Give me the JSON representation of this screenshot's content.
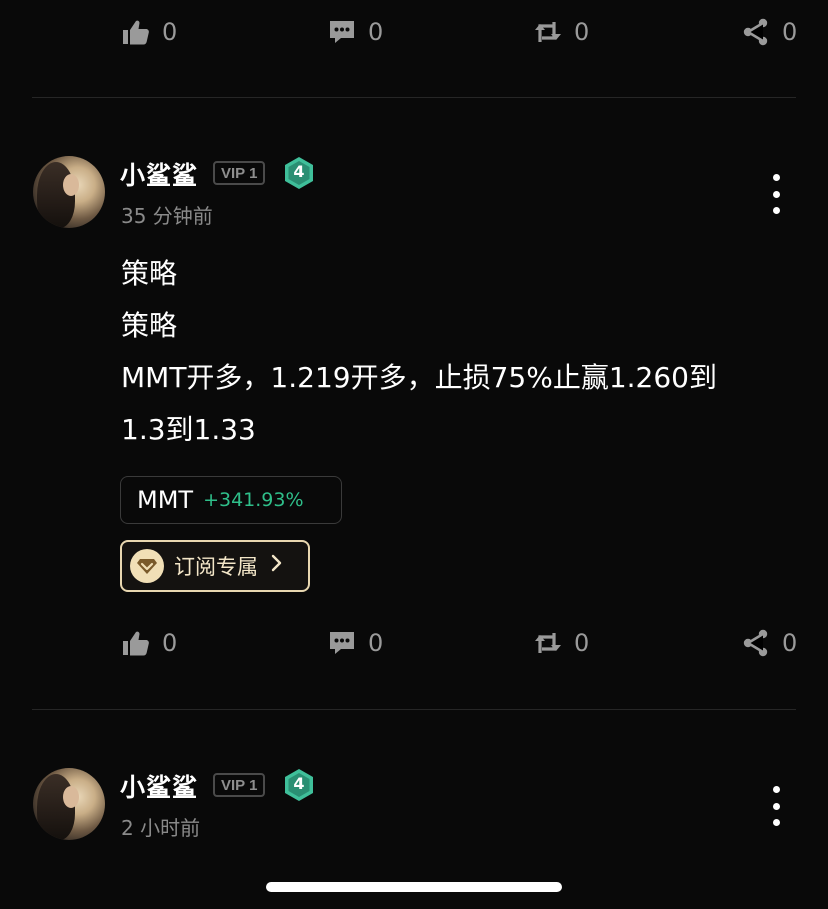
{
  "top_actions": {
    "like_count": "0",
    "comment_count": "0",
    "repost_count": "0",
    "share_count": "0"
  },
  "post": {
    "author": "小鲨鲨",
    "vip_label": "VIP 1",
    "level": "4",
    "time": "35 分钟前",
    "lines": [
      "策略",
      "策略",
      "MMT开多，1.219开多，止损75%止赢1.260到",
      "1.3到1.33"
    ],
    "ticker": {
      "symbol": "MMT",
      "change": "+341.93%"
    },
    "subscribe_label": "订阅专属",
    "actions": {
      "like_count": "0",
      "comment_count": "0",
      "repost_count": "0",
      "share_count": "0"
    }
  },
  "next_post": {
    "author": "小鲨鲨",
    "vip_label": "VIP 1",
    "level": "4",
    "time": "2 小时前"
  },
  "colors": {
    "background": "#090909",
    "muted_text": "#8a8a8a",
    "positive": "#2fbf8a",
    "level_badge": "#3fbf9a",
    "subscribe_border": "#e8d7b0"
  },
  "icons": {
    "like": "thumbs-up-icon",
    "comment": "comment-icon",
    "repost": "repost-icon",
    "share": "share-icon",
    "more": "more-vertical-icon",
    "subscribe": "diamond-icon",
    "chevron": "chevron-right-icon"
  }
}
